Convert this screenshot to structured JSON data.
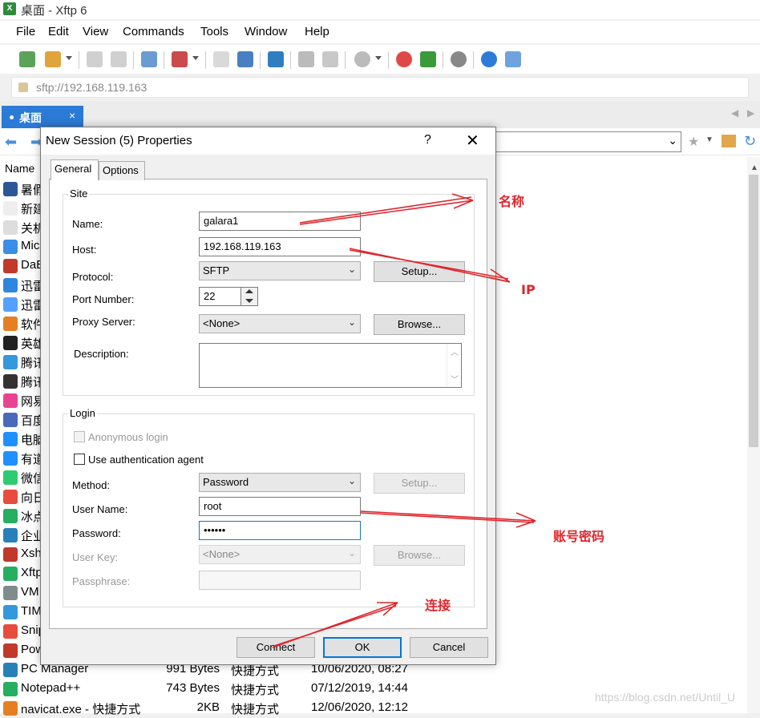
{
  "window": {
    "title": "桌面 - Xftp 6"
  },
  "menu": [
    "File",
    "Edit",
    "View",
    "Commands",
    "Tools",
    "Window",
    "Help"
  ],
  "address": {
    "url": "sftp://192.168.119.163"
  },
  "tab": {
    "label": "桌面",
    "close": "×"
  },
  "file_pane": {
    "column_name": "Name",
    "rows": [
      {
        "name": "暑假",
        "size": "",
        "type": "",
        "date": "",
        "color": "#2b5797"
      },
      {
        "name": "新建",
        "size": "",
        "type": "",
        "date": "",
        "color": "#eeeeee"
      },
      {
        "name": "关机",
        "size": "",
        "type": "",
        "date": "",
        "color": "#dddddd"
      },
      {
        "name": "Mic",
        "size": "",
        "type": "",
        "date": "",
        "color": "#3a8ee6"
      },
      {
        "name": "DaB",
        "size": "",
        "type": "",
        "date": "",
        "color": "#c0392b"
      },
      {
        "name": "迅雷",
        "size": "",
        "type": "",
        "date": "",
        "color": "#2e86de"
      },
      {
        "name": "迅雷",
        "size": "",
        "type": "",
        "date": "",
        "color": "#54a0ff"
      },
      {
        "name": "软件",
        "size": "",
        "type": "",
        "date": "",
        "color": "#e67e22"
      },
      {
        "name": "英雄",
        "size": "",
        "type": "",
        "date": "",
        "color": "#222222"
      },
      {
        "name": "腾讯",
        "size": "",
        "type": "",
        "date": "",
        "color": "#3498db"
      },
      {
        "name": "腾讯",
        "size": "",
        "type": "",
        "date": "",
        "color": "#333333"
      },
      {
        "name": "网易",
        "size": "",
        "type": "",
        "date": "",
        "color": "#e84393"
      },
      {
        "name": "百度",
        "size": "",
        "type": "",
        "date": "",
        "color": "#4a69bd"
      },
      {
        "name": "电脑",
        "size": "",
        "type": "",
        "date": "",
        "color": "#1e90ff"
      },
      {
        "name": "有道",
        "size": "",
        "type": "",
        "date": "",
        "color": "#1e90ff"
      },
      {
        "name": "微信",
        "size": "",
        "type": "",
        "date": "",
        "color": "#2ecc71"
      },
      {
        "name": "向日",
        "size": "",
        "type": "",
        "date": "",
        "color": "#e74c3c"
      },
      {
        "name": "冰点",
        "size": "",
        "type": "",
        "date": "",
        "color": "#27ae60"
      },
      {
        "name": "企业",
        "size": "",
        "type": "",
        "date": "",
        "color": "#2980b9"
      },
      {
        "name": "Xsh",
        "size": "",
        "type": "",
        "date": "",
        "color": "#c0392b"
      },
      {
        "name": "Xftp",
        "size": "",
        "type": "",
        "date": "",
        "color": "#27ae60"
      },
      {
        "name": "VM",
        "size": "",
        "type": "",
        "date": "",
        "color": "#7f8c8d"
      },
      {
        "name": "TIM",
        "size": "",
        "type": "",
        "date": "",
        "color": "#3498db"
      },
      {
        "name": "Snip",
        "size": "",
        "type": "",
        "date": "",
        "color": "#e74c3c"
      },
      {
        "name": "Pow",
        "size": "",
        "type": "",
        "date": "",
        "color": "#c0392b"
      },
      {
        "name": "PC Manager",
        "size": "991 Bytes",
        "type": "快捷方式",
        "date": "10/06/2020, 08:27",
        "color": "#2980b9"
      },
      {
        "name": "Notepad++",
        "size": "743 Bytes",
        "type": "快捷方式",
        "date": "07/12/2019, 14:44",
        "color": "#27ae60"
      },
      {
        "name": "navicat.exe - 快捷方式",
        "size": "2KB",
        "type": "快捷方式",
        "date": "12/06/2020, 12:12",
        "color": "#e67e22"
      }
    ]
  },
  "dialog": {
    "title": "New Session (5) Properties",
    "help": "?",
    "close": "✕",
    "tabs": [
      "General",
      "Options"
    ],
    "site": {
      "group_label": "Site",
      "name_label": "Name:",
      "name_value": "galara1",
      "host_label": "Host:",
      "host_value": "192.168.119.163",
      "protocol_label": "Protocol:",
      "protocol_value": "SFTP",
      "setup_label": "Setup...",
      "port_label": "Port Number:",
      "port_value": "22",
      "proxy_label": "Proxy Server:",
      "proxy_value": "<None>",
      "browse_label": "Browse...",
      "description_label": "Description:",
      "description_value": ""
    },
    "login": {
      "group_label": "Login",
      "anonymous_label": "Anonymous login",
      "agent_label": "Use authentication agent",
      "method_label": "Method:",
      "method_value": "Password",
      "setup_label": "Setup...",
      "username_label": "User Name:",
      "username_value": "root",
      "password_label": "Password:",
      "password_value": "••••••",
      "userkey_label": "User Key:",
      "userkey_value": "<None>",
      "browse_label": "Browse...",
      "passphrase_label": "Passphrase:",
      "passphrase_value": ""
    },
    "buttons": {
      "connect": "Connect",
      "ok": "OK",
      "cancel": "Cancel"
    }
  },
  "annotations": {
    "name": "名称",
    "ip": "IP",
    "account": "账号密码",
    "connect": "连接",
    "color": "#e0252c"
  },
  "watermark": "https://blog.csdn.net/Until_U"
}
